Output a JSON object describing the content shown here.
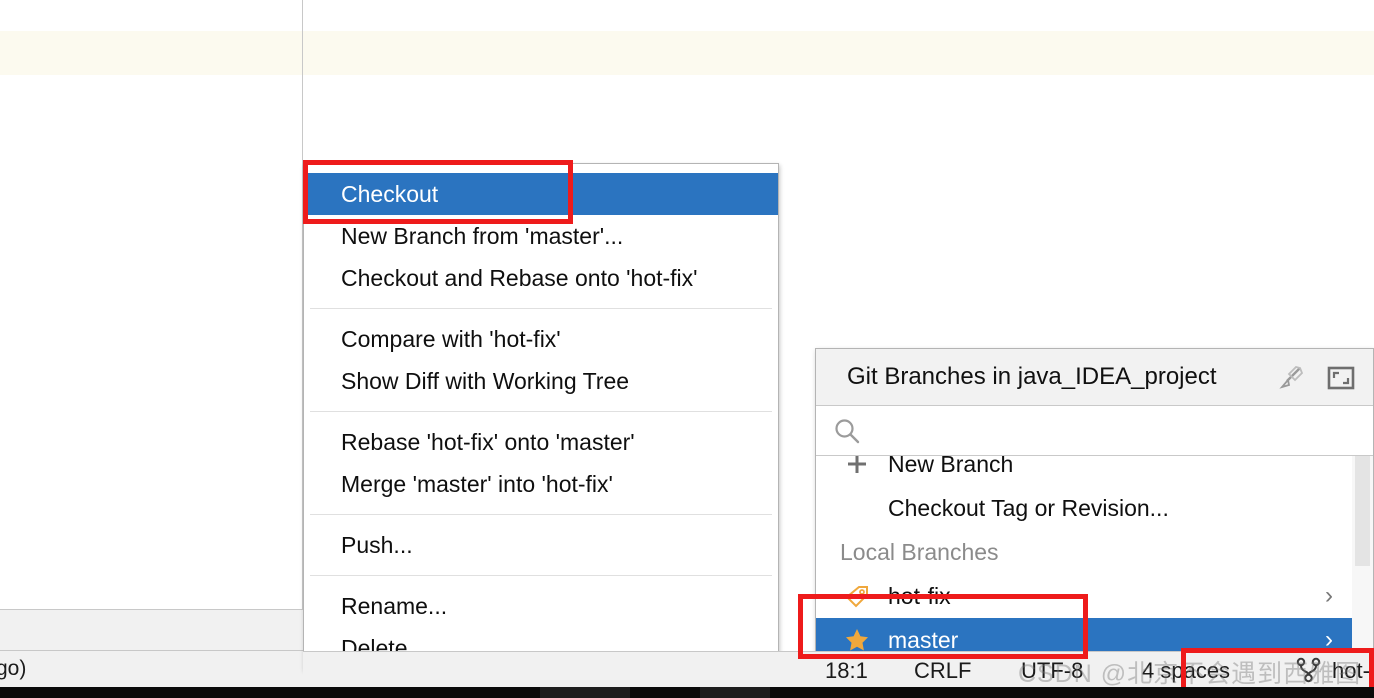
{
  "app": {
    "editor": {
      "bottom_left_text": "go)"
    }
  },
  "context_menu": {
    "name": "git-branch-context-menu",
    "items": [
      {
        "label": "Checkout",
        "selected": true,
        "separator_after": false
      },
      {
        "label": "New Branch from 'master'...",
        "selected": false,
        "separator_after": false
      },
      {
        "label": "Checkout and Rebase onto 'hot-fix'",
        "selected": false,
        "separator_after": true
      },
      {
        "label": "Compare with 'hot-fix'",
        "selected": false,
        "separator_after": false
      },
      {
        "label": "Show Diff with Working Tree",
        "selected": false,
        "separator_after": true
      },
      {
        "label": "Rebase 'hot-fix' onto 'master'",
        "selected": false,
        "separator_after": false
      },
      {
        "label": "Merge 'master' into 'hot-fix'",
        "selected": false,
        "separator_after": true
      },
      {
        "label": "Push...",
        "selected": false,
        "separator_after": true
      },
      {
        "label": "Rename...",
        "selected": false,
        "separator_after": false
      },
      {
        "label": "Delete",
        "selected": false,
        "separator_after": false
      }
    ]
  },
  "git_popup": {
    "title": "Git Branches in java_IDEA_project",
    "icons": {
      "pin": "pin-arrow-icon",
      "restore": "restore-window-icon"
    },
    "search": {
      "value": "",
      "placeholder": ""
    },
    "rows": [
      {
        "type": "action",
        "label": "New Branch",
        "icon": "plus-icon",
        "selected": false,
        "chevron": false
      },
      {
        "type": "action",
        "label": "Checkout Tag or Revision...",
        "icon": "none",
        "selected": false,
        "chevron": false
      },
      {
        "type": "section",
        "label": "Local Branches",
        "icon": "none",
        "selected": false,
        "chevron": false
      },
      {
        "type": "branch",
        "label": "hot-fix",
        "icon": "tag-icon",
        "selected": false,
        "chevron": true
      },
      {
        "type": "branch",
        "label": "master",
        "icon": "star-icon",
        "selected": true,
        "chevron": true
      }
    ],
    "chevron_glyph": "›"
  },
  "status_bar": {
    "caret_position": "18:1",
    "line_separator": "CRLF",
    "encoding": "UTF-8",
    "indent": "4 spaces",
    "branch": "hot-fix",
    "branch_icon": "git-branch-icon",
    "lock_icon": "lock-icon"
  },
  "annotations": [
    {
      "name": "annotation-checkout",
      "color": "#ee1b1b"
    },
    {
      "name": "annotation-master-branch",
      "color": "#ee1b1b"
    },
    {
      "name": "annotation-status-branch",
      "color": "#ee1b1b"
    }
  ],
  "watermark": {
    "text": "CSDN @北京不会遇到西雅图"
  },
  "colors": {
    "selection_blue": "#2b74c0",
    "caret_line": "#fcfaef",
    "annotation_red": "#ee1b1b",
    "star_gold": "#f0a83c"
  }
}
